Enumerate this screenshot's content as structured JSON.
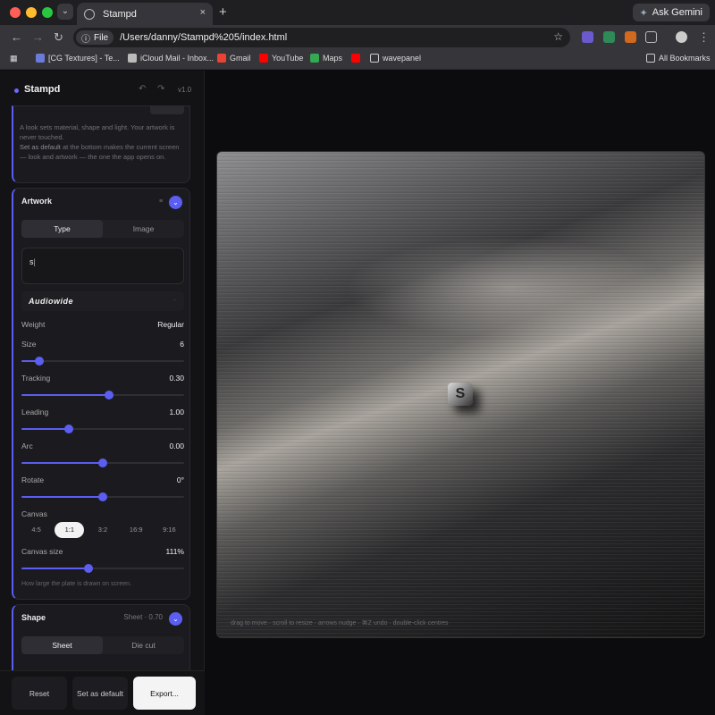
{
  "browser": {
    "tab_title": "Stampd",
    "new_tab": "+",
    "close": "×",
    "gemini": "Ask Gemini",
    "file_chip": "File",
    "url": "/Users/danny/Stampd%205/index.html",
    "bookmarks": [
      "[CG Textures] - Te...",
      "iCloud Mail - Inbox...",
      "Gmail",
      "YouTube",
      "Maps",
      "wavepanel"
    ],
    "all_bookmarks": "All Bookmarks"
  },
  "app": {
    "brand": "Stampd",
    "version": "v1.0",
    "looks_note_1": "A look sets material, shape and light. Your artwork is never touched.",
    "looks_note_2_bold": "Set as default",
    "looks_note_2": " at the bottom makes the current screen — look and artwork — the one the app opens on.",
    "artwork": {
      "title": "Artwork",
      "marker": "≡",
      "tabs": [
        "Type",
        "Image"
      ],
      "active_tab": "Type",
      "text_value": "s",
      "font": "Audiowide",
      "font_caret": "·",
      "weight_label": "Weight",
      "weight_value": "Regular",
      "sliders": [
        {
          "label": "Size",
          "value": "6",
          "level": 0.11
        },
        {
          "label": "Tracking",
          "value": "0.30",
          "level": 0.54
        },
        {
          "label": "Leading",
          "value": "1.00",
          "level": 0.29
        },
        {
          "label": "Arc",
          "value": "0.00",
          "level": 0.5
        },
        {
          "label": "Rotate",
          "value": "0°",
          "level": 0.5
        }
      ],
      "canvas_label": "Canvas",
      "ratios": [
        "4:5",
        "1:1",
        "3:2",
        "16:9",
        "9:16"
      ],
      "active_ratio": "1:1",
      "canvas_size_label": "Canvas size",
      "canvas_size_value": "111%",
      "canvas_size_level": 0.41,
      "canvas_hint": "How large the plate is drawn on screen."
    },
    "shape": {
      "title": "Shape",
      "summary": "Sheet · 0.70",
      "tabs": [
        "Sheet",
        "Die cut"
      ],
      "active_tab": "Sheet"
    },
    "buttons": {
      "reset": "Reset",
      "set_default": "Set as default",
      "export": "Export..."
    },
    "stage_hint": "drag to move · scroll to resize · arrows nudge · ⌘Z undo · double-click centres",
    "stamp_glyph": "S"
  },
  "colors": {
    "accent": "#5b5ef0"
  }
}
